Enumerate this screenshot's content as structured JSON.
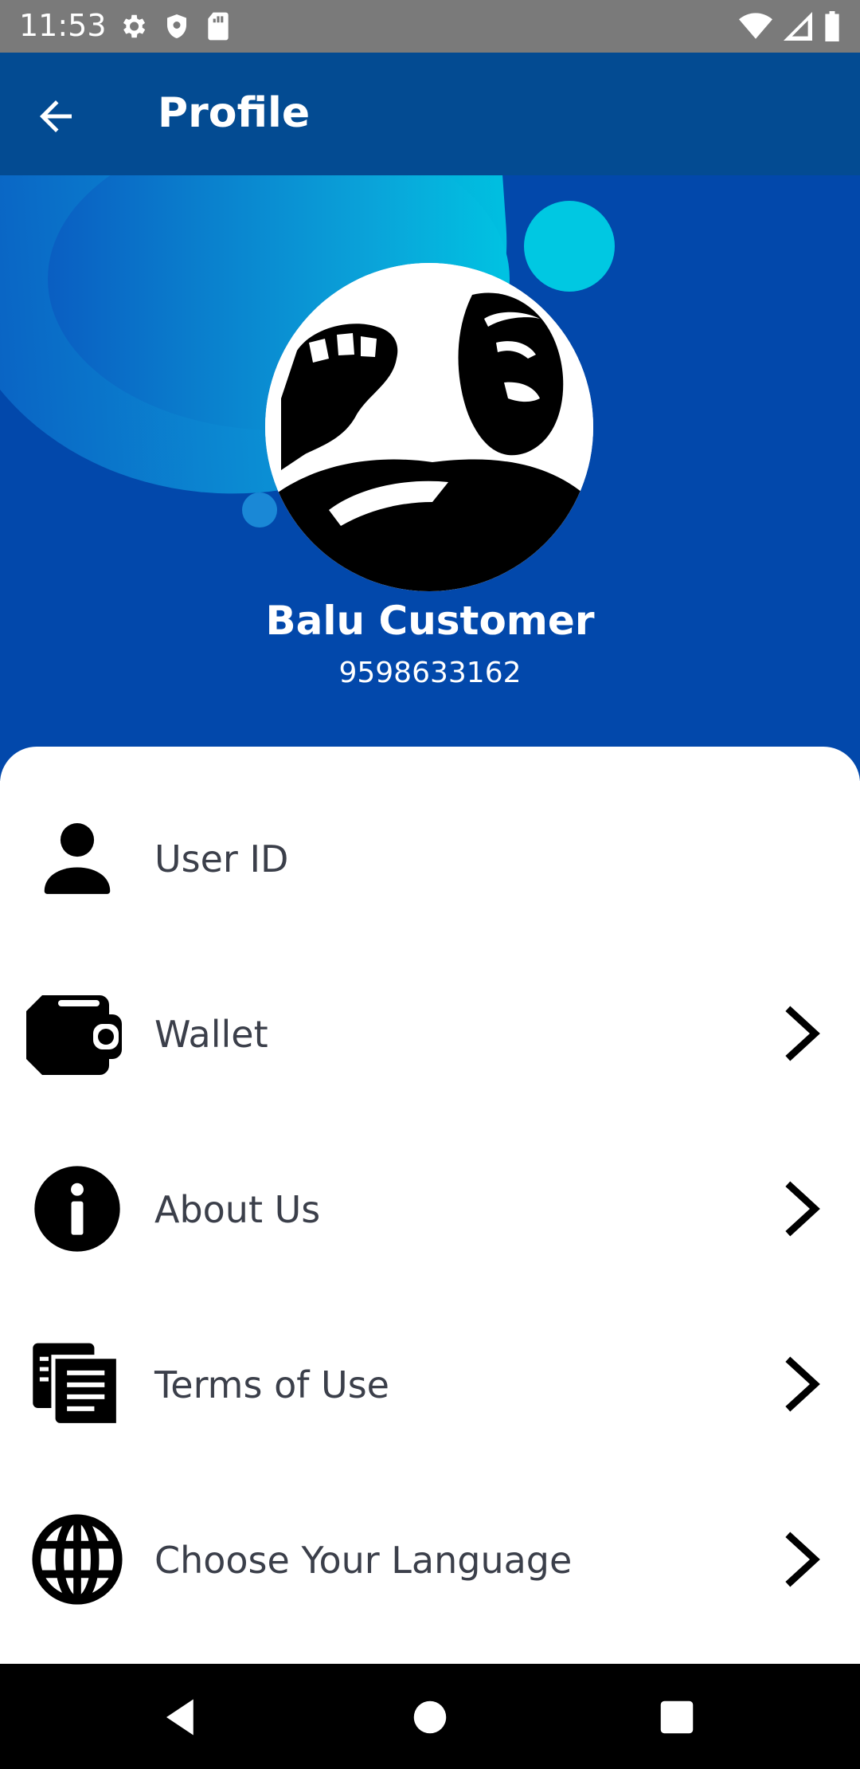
{
  "status_bar": {
    "time": "11:53",
    "left_icons": [
      "settings-icon",
      "shield-icon",
      "sd-card-icon"
    ],
    "right_icons": [
      "wifi-icon",
      "signal-icon",
      "battery-icon"
    ]
  },
  "app_bar": {
    "title": "Profile",
    "back_icon": "arrow-left-icon"
  },
  "profile": {
    "name": "Balu Customer",
    "phone": "9598633162"
  },
  "menu": {
    "items": [
      {
        "label": "User ID",
        "icon": "user-icon",
        "has_chevron": false
      },
      {
        "label": "Wallet",
        "icon": "wallet-icon",
        "has_chevron": true
      },
      {
        "label": "About Us",
        "icon": "info-icon",
        "has_chevron": true
      },
      {
        "label": "Terms of Use",
        "icon": "document-icon",
        "has_chevron": true
      },
      {
        "label": "Choose Your Language",
        "icon": "globe-icon",
        "has_chevron": true
      }
    ]
  },
  "nav_bar": {
    "buttons": [
      "back-triangle-icon",
      "home-circle-icon",
      "recents-square-icon"
    ]
  },
  "colors": {
    "status_bar": "#7a7a7a",
    "app_bar": "#034b92",
    "header": "#0248ab",
    "accent_cyan": "#00c8e2",
    "menu_text": "#3b3f4a"
  }
}
